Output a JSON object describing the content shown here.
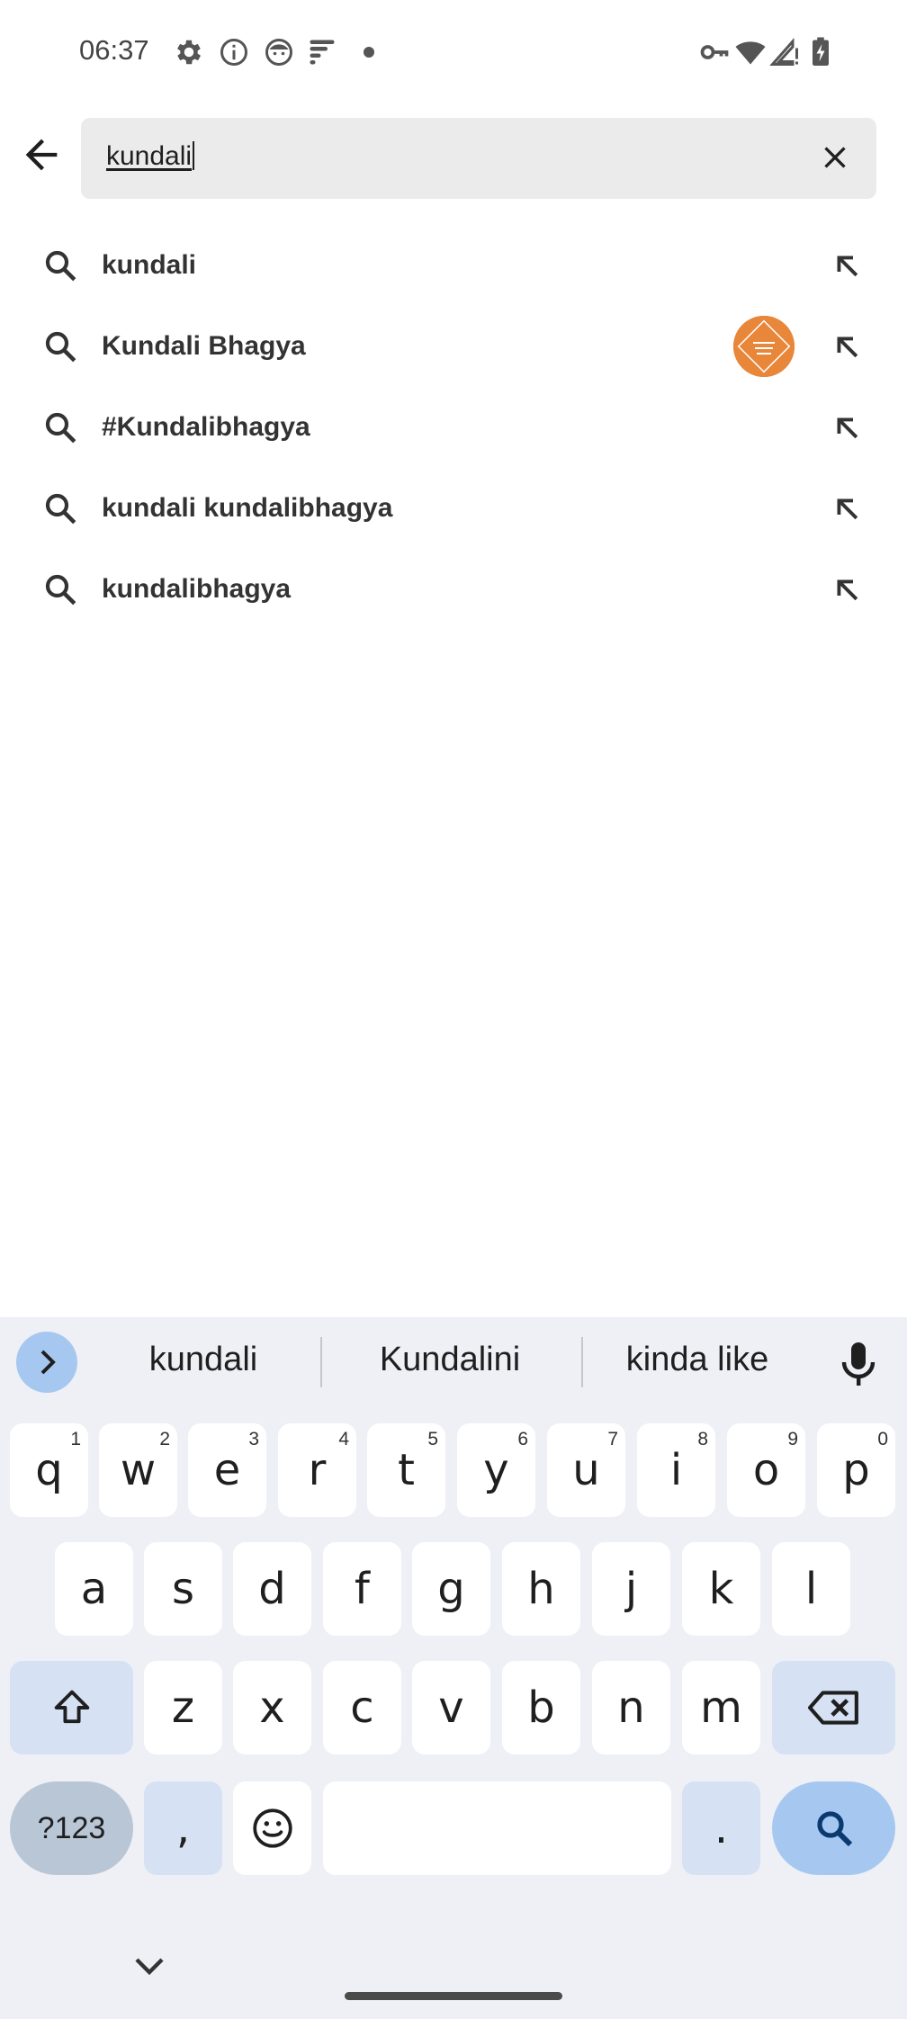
{
  "status_bar": {
    "time": "06:37",
    "left_icons": [
      "settings-icon",
      "info-icon",
      "face-icon",
      "fitbit-icon",
      "notification-dot-icon"
    ],
    "right_icons": [
      "vpn-key-icon",
      "wifi-icon",
      "cell-signal-icon",
      "battery-charging-icon"
    ]
  },
  "search": {
    "back_icon": "arrow-back-icon",
    "query": "kundali",
    "clear_icon": "close-icon"
  },
  "suggestions": [
    {
      "label": "kundali",
      "has_avatar": false
    },
    {
      "label": "Kundali Bhagya",
      "has_avatar": true,
      "avatar_color": "#e8863a"
    },
    {
      "label": "#Kundalibhagya",
      "has_avatar": false
    },
    {
      "label": "kundali kundalibhagya",
      "has_avatar": false
    },
    {
      "label": "kundalibhagya",
      "has_avatar": false
    }
  ],
  "keyboard": {
    "suggestions": [
      "kundali",
      "Kundalini",
      "kinda like"
    ],
    "row1": [
      {
        "key": "q",
        "num": "1"
      },
      {
        "key": "w",
        "num": "2"
      },
      {
        "key": "e",
        "num": "3"
      },
      {
        "key": "r",
        "num": "4"
      },
      {
        "key": "t",
        "num": "5"
      },
      {
        "key": "y",
        "num": "6"
      },
      {
        "key": "u",
        "num": "7"
      },
      {
        "key": "i",
        "num": "8"
      },
      {
        "key": "o",
        "num": "9"
      },
      {
        "key": "p",
        "num": "0"
      }
    ],
    "row2": [
      "a",
      "s",
      "d",
      "f",
      "g",
      "h",
      "j",
      "k",
      "l"
    ],
    "row3": [
      "z",
      "x",
      "c",
      "v",
      "b",
      "n",
      "m"
    ],
    "symbols_label": "?123",
    "comma": ",",
    "period": ".",
    "colors": {
      "background": "#eef0f6",
      "modifier": "#d6e2f4",
      "action": "#a6c8f0"
    }
  }
}
